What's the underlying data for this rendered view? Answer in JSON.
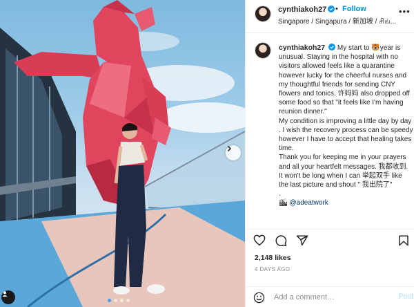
{
  "post": {
    "username": "cynthiakoh27",
    "separator": "•",
    "follow_label": "Follow",
    "location": "Singapore / Singapura / 新加坡 / சிங்...",
    "more_icon": "more-horizontal-icon",
    "caption_lines": [
      "My start to 🐯year is unusual. Staying in the hospital with no visitors allowed feels like a quarantine however lucky for the cheerful nurses and my thoughtful friends for sending CNY flowers and tonics. 许妈妈 also dropped off some food so that \"it feels like I'm having reunion dinner.\"",
      "My condition is improving a little day by day . I wish the recovery process can be speedy however I have to accept that healing takes time.",
      "Thank you for keeping me in your prayers and all your heartfelt messages. 我都收到.",
      "It won't be long when I can 举起双手 like the last picture and shout \" 我出院了\"",
      "."
    ],
    "mention_prefix": "🏙",
    "mention": "@adeatwork",
    "likes": "2,148 likes",
    "date": "4 DAYS AGO",
    "comment_placeholder": "Add a comment…",
    "post_button": "Post"
  },
  "carousel": {
    "total_slides": 4,
    "active_slide": 1
  },
  "icons": {
    "like": "heart-icon",
    "comment": "comment-icon",
    "share": "share-icon",
    "save": "bookmark-icon",
    "emoji": "emoji-icon",
    "next": "chevron-right-icon",
    "tag": "user-tag-icon",
    "verified": "verified-badge-icon"
  },
  "colors": {
    "link_blue": "#0095f6",
    "verified_blue": "#0095f6",
    "post_button_disabled": "#b2dffc",
    "bear_red": "#e0455d"
  }
}
